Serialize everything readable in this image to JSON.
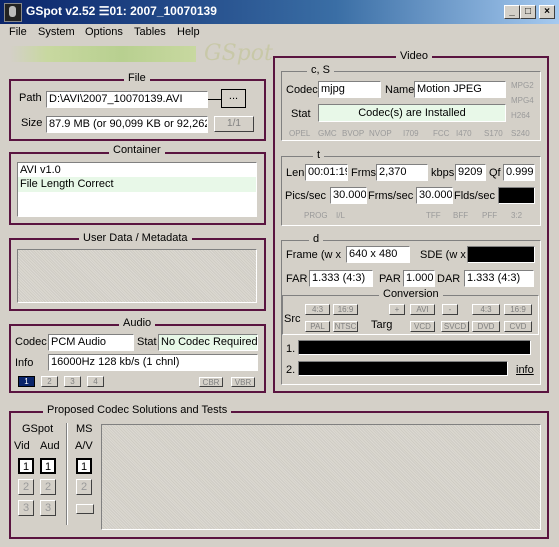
{
  "window": {
    "title": "GSpot v2.52 ☰01: 2007_10070139",
    "min": "_",
    "max": "□",
    "close": "×"
  },
  "menu": [
    "File",
    "System",
    "Options",
    "Tables",
    "Help"
  ],
  "logo_text": "GSpot",
  "file": {
    "title": "File",
    "path_label": "Path",
    "path_value": "D:\\AVI\\2007_10070139.AVI",
    "browse_label": "...",
    "size_label": "Size",
    "size_value": "87.9 MB (or 90,099 KB or 92,262,",
    "page_label": "1/1"
  },
  "container": {
    "title": "Container",
    "lines": [
      "AVI v1.0",
      "File Length Correct"
    ]
  },
  "userdata": {
    "title": "User Data / Metadata"
  },
  "audio": {
    "title": "Audio",
    "codec_label": "Codec",
    "codec_value": "PCM Audio",
    "stat_label": "Stat",
    "stat_value": "No Codec Required",
    "info_label": "Info",
    "info_value": "16000Hz  128 kb/s (1 chnl)",
    "streams": [
      "1",
      "2",
      "3",
      "4"
    ],
    "cbr": "CBR",
    "vbr": "VBR"
  },
  "video": {
    "title": "Video",
    "cs_title": "c, S",
    "codec_label": "Codec",
    "codec_value": "mjpg",
    "name_label": "Name",
    "name_value": "Motion JPEG",
    "stat_label": "Stat",
    "stat_value": "Codec(s) are Installed",
    "side_tags": [
      "MPG2",
      "MPG4",
      "H264"
    ],
    "bottom_tags": [
      "OPEL",
      "GMC",
      "BVOP",
      "NVOP",
      "I709",
      "FCC",
      "I470",
      "S170",
      "S240"
    ],
    "t_title": "t",
    "len_label": "Len",
    "len_value": "00:01:19",
    "frms_label": "Frms",
    "frms_value": "2,370",
    "kbps_label": "kbps",
    "kbps_value": "9209",
    "qf_label": "Qf",
    "qf_value": "0.999",
    "pics_label": "Pics/sec",
    "pics_value": "30.000",
    "frmssec_label": "Frms/sec",
    "frmssec_value": "30.000",
    "flds_label": "Flds/sec",
    "t_tags": [
      "PROG",
      "I/L",
      "TFF",
      "BFF",
      "PFF",
      "3:2"
    ],
    "d_title": "d",
    "frame_label": "Frame (w x",
    "frame_value": "640 x 480",
    "sde_label": "SDE (w x",
    "far_label": "FAR",
    "far_value": "1.333 (4:3)",
    "par_label": "PAR",
    "par_value": "1.000",
    "dar_label": "DAR",
    "dar_value": "1.333 (4:3)",
    "conv_title": "Conversion",
    "src_label": "Src",
    "targ_label": "Targ",
    "src_btns": [
      "4:3",
      "16:9",
      "PAL",
      "NTSC"
    ],
    "targ_btns": [
      "+",
      "AVI",
      "-",
      "4:3",
      "16:9",
      "VCD",
      "SVCD",
      "DVD",
      "CVD"
    ],
    "line1": "1.",
    "line2": "2.",
    "info_link": "info"
  },
  "proposed": {
    "title": "Proposed Codec Solutions and Tests",
    "gspot_label": "GSpot",
    "vid_label": "Vid",
    "aud_label": "Aud",
    "ms_label": "MS",
    "av_label": "A/V",
    "nums": [
      "1",
      "2",
      "3"
    ]
  }
}
